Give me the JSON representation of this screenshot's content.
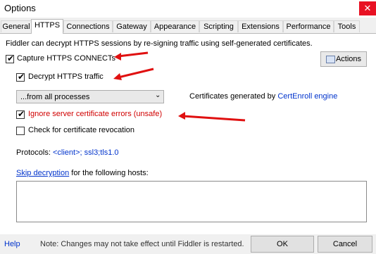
{
  "window": {
    "title": "Options",
    "close_glyph": "✕"
  },
  "tabs": [
    {
      "label": "General"
    },
    {
      "label": "HTTPS",
      "active": true
    },
    {
      "label": "Connections"
    },
    {
      "label": "Gateway"
    },
    {
      "label": "Appearance"
    },
    {
      "label": "Scripting"
    },
    {
      "label": "Extensions"
    },
    {
      "label": "Performance"
    },
    {
      "label": "Tools"
    }
  ],
  "https": {
    "intro": "Fiddler can decrypt HTTPS sessions by re-signing traffic using self-generated certificates.",
    "capture_label": "Capture HTTPS CONNECTs",
    "capture_checked": true,
    "actions_label": "Actions",
    "decrypt_label": "Decrypt HTTPS traffic",
    "decrypt_checked": true,
    "process_filter_value": "...from all processes",
    "cert_gen_prefix": "Certificates generated by",
    "cert_gen_engine": "CertEnroll engine",
    "ignore_errors_label": "Ignore server certificate errors (unsafe)",
    "ignore_errors_checked": true,
    "revocation_label": "Check for certificate revocation",
    "revocation_checked": false,
    "protocols_label": "Protocols:",
    "protocols_value": "<client>; ssl3;tls1.0",
    "skip_link": "Skip decryption",
    "skip_suffix": "for the following hosts:",
    "hosts_value": ""
  },
  "footer": {
    "help_label": "Help",
    "note": "Note: Changes may not take effect until Fiddler is restarted.",
    "ok_label": "OK",
    "cancel_label": "Cancel"
  },
  "colors": {
    "annotation_arrow": "#e01010",
    "link": "#0033cc",
    "warning_text": "#d00000",
    "close_button": "#e81123"
  }
}
